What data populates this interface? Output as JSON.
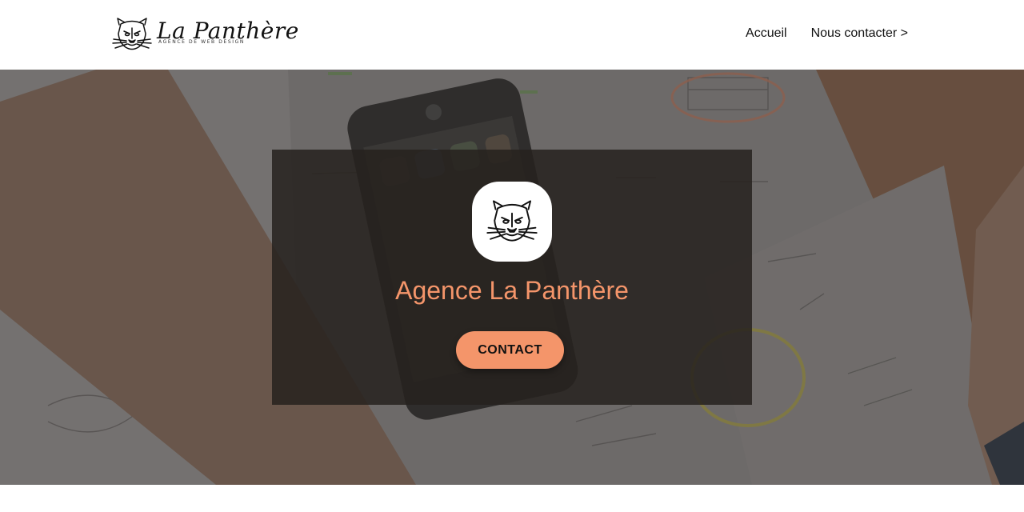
{
  "header": {
    "brand": {
      "name": "La Panthère",
      "tagline": "AGENCE DE WEB DESIGN",
      "icon": "panther-icon"
    },
    "nav": [
      {
        "label": "Accueil"
      },
      {
        "label": "Nous contacter >"
      }
    ]
  },
  "hero": {
    "background": "office-desk-photo",
    "card": {
      "icon": "panther-icon",
      "title": "Agence La Panthère",
      "cta_label": "CONTACT"
    }
  },
  "colors": {
    "accent": "#f4956a",
    "card_background": "#26221e",
    "header_background": "#ffffff"
  }
}
